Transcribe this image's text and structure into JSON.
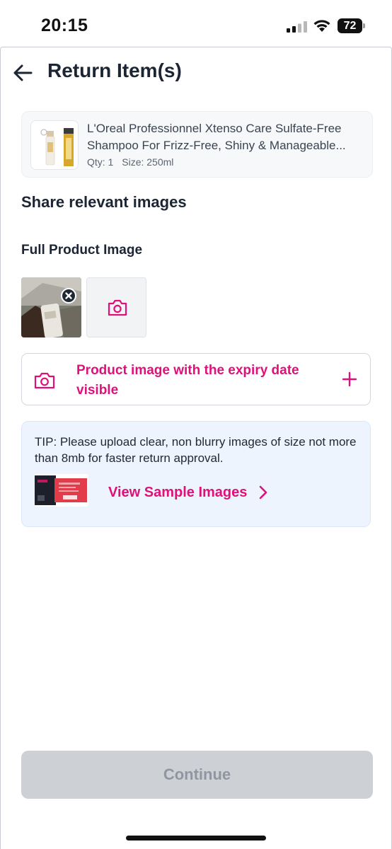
{
  "status_bar": {
    "time": "20:15",
    "battery_level": "72",
    "icons": [
      "cellular-signal-icon",
      "wifi-icon",
      "battery-icon"
    ]
  },
  "header": {
    "back_icon": "arrow-left-icon",
    "title": "Return Item(s)"
  },
  "product": {
    "name_line1": "L'Oreal Professionnel Xtenso Care Sulfate-Free",
    "name_line2": "Shampoo For Frizz-Free, Shiny & Manageable...",
    "qty": "Qty: 1",
    "size": "Size: 250ml"
  },
  "images_section": {
    "title": "Share relevant images",
    "full_product_label": "Full Product Image",
    "remove_icon": "close-icon",
    "add_photo_icon": "camera-icon"
  },
  "expiry_row": {
    "label": "Product image with the expiry date visible",
    "icon": "camera-icon",
    "action_icon": "plus-icon"
  },
  "tip": {
    "text": "TIP: Please upload clear, non blurry images of size not more than 8mb for faster return approval.",
    "link_label": "View Sample Images",
    "link_icon": "chevron-right-icon"
  },
  "footer": {
    "continue_label": "Continue",
    "continue_enabled": false
  },
  "colors": {
    "accent": "#e0107a",
    "title_text": "#1b2533",
    "tip_background": "#eef4fe",
    "disabled_button": "#cdd0d5"
  }
}
